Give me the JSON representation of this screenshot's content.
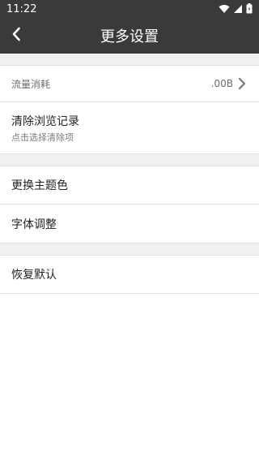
{
  "statusbar": {
    "time": "11:22",
    "icons": [
      "wifi-icon",
      "signal-icon",
      "battery-icon"
    ]
  },
  "header": {
    "title": "更多设置",
    "back_icon": "back-arrow-icon"
  },
  "settings": {
    "traffic": {
      "label": "流量消耗",
      "value": ".00B",
      "icon": "chevron-right-icon"
    },
    "clear_history": {
      "label": "清除浏览记录",
      "subtitle": "点击选择清除项"
    },
    "theme_color": {
      "label": "更换主题色"
    },
    "font_adjust": {
      "label": "字体调整"
    },
    "restore_default": {
      "label": "恢复默认"
    }
  },
  "colors": {
    "bar": "#3a3a3a",
    "section_gap": "#f0f0f0",
    "divider": "#e2e2e2"
  }
}
